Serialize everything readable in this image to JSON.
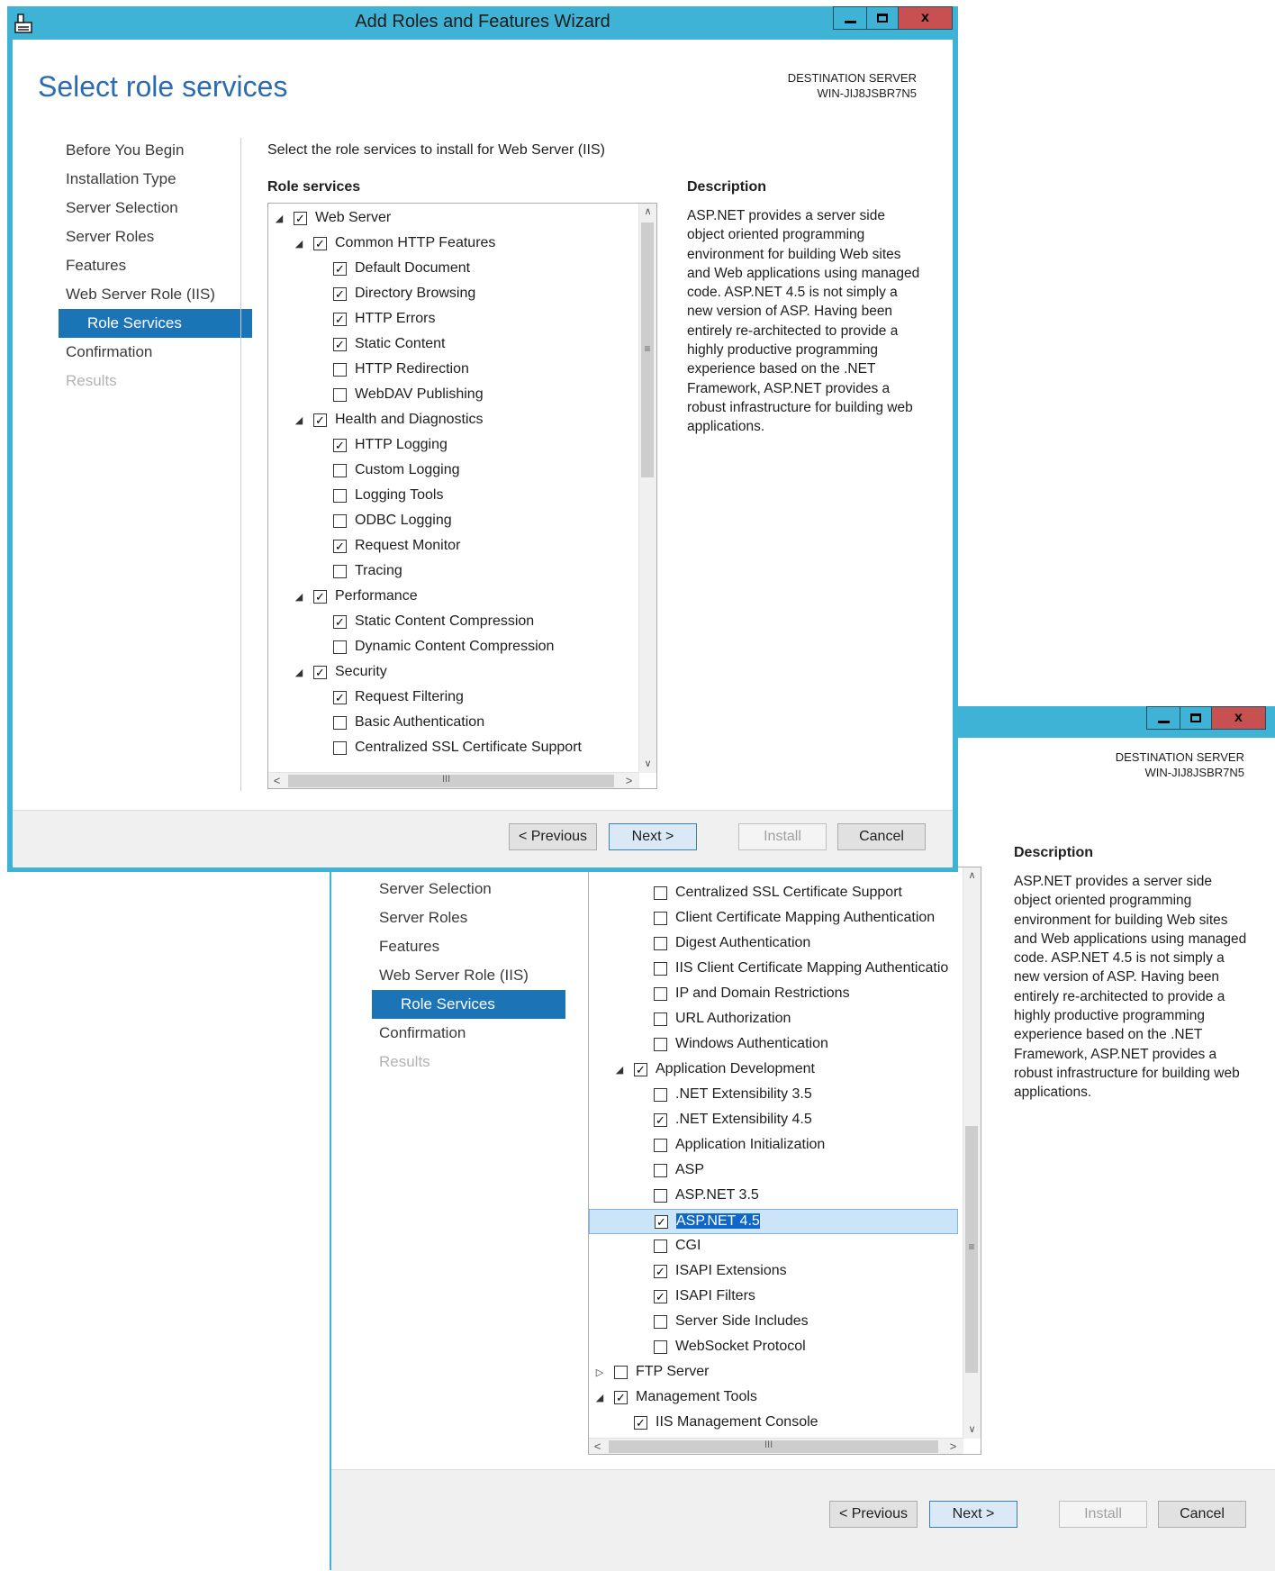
{
  "wizard_title": "Add Roles and Features Wizard",
  "heading": "Select role services",
  "destination": {
    "label": "DESTINATION SERVER",
    "server": "WIN-JIJ8JSBR7N5"
  },
  "nav_items": [
    {
      "label": "Before You Begin",
      "state": "normal"
    },
    {
      "label": "Installation Type",
      "state": "normal"
    },
    {
      "label": "Server Selection",
      "state": "normal"
    },
    {
      "label": "Server Roles",
      "state": "normal"
    },
    {
      "label": "Features",
      "state": "normal"
    },
    {
      "label": "Web Server Role (IIS)",
      "state": "normal"
    },
    {
      "label": "Role Services",
      "state": "selected"
    },
    {
      "label": "Confirmation",
      "state": "normal"
    },
    {
      "label": "Results",
      "state": "disabled"
    }
  ],
  "instruction": "Select the role services to install for Web Server (IIS)",
  "role_services_label": "Role services",
  "description_label": "Description",
  "description_text": "ASP.NET provides a server side object oriented programming environment for building Web sites and Web applications using managed code. ASP.NET 4.5 is not simply a new version of ASP. Having been entirely re-architected to provide a highly productive programming experience based on the .NET Framework, ASP.NET provides a robust infrastructure for building web applications.",
  "buttons": {
    "previous": "< Previous",
    "next": "Next >",
    "install": "Install",
    "cancel": "Cancel"
  },
  "window_buttons": {
    "close": "x"
  },
  "scroll_glyphs": {
    "up": "∧",
    "down": "∨",
    "left": "<",
    "right": ">",
    "grip_v": "≡",
    "grip_h": "III"
  },
  "tree_top": [
    {
      "label": "Web Server",
      "level": 0,
      "checked": true,
      "expander": "expanded"
    },
    {
      "label": "Common HTTP Features",
      "level": 1,
      "checked": true,
      "expander": "expanded"
    },
    {
      "label": "Default Document",
      "level": 2,
      "checked": true
    },
    {
      "label": "Directory Browsing",
      "level": 2,
      "checked": true
    },
    {
      "label": "HTTP Errors",
      "level": 2,
      "checked": true
    },
    {
      "label": "Static Content",
      "level": 2,
      "checked": true
    },
    {
      "label": "HTTP Redirection",
      "level": 2,
      "checked": false
    },
    {
      "label": "WebDAV Publishing",
      "level": 2,
      "checked": false
    },
    {
      "label": "Health and Diagnostics",
      "level": 1,
      "checked": true,
      "expander": "expanded"
    },
    {
      "label": "HTTP Logging",
      "level": 2,
      "checked": true
    },
    {
      "label": "Custom Logging",
      "level": 2,
      "checked": false
    },
    {
      "label": "Logging Tools",
      "level": 2,
      "checked": false
    },
    {
      "label": "ODBC Logging",
      "level": 2,
      "checked": false
    },
    {
      "label": "Request Monitor",
      "level": 2,
      "checked": true
    },
    {
      "label": "Tracing",
      "level": 2,
      "checked": false
    },
    {
      "label": "Performance",
      "level": 1,
      "checked": true,
      "expander": "expanded"
    },
    {
      "label": "Static Content Compression",
      "level": 2,
      "checked": true
    },
    {
      "label": "Dynamic Content Compression",
      "level": 2,
      "checked": false
    },
    {
      "label": "Security",
      "level": 1,
      "checked": true,
      "expander": "expanded"
    },
    {
      "label": "Request Filtering",
      "level": 2,
      "checked": true
    },
    {
      "label": "Basic Authentication",
      "level": 2,
      "checked": false
    },
    {
      "label": "Centralized SSL Certificate Support",
      "level": 2,
      "checked": false
    }
  ],
  "tree_bottom": [
    {
      "label": "Centralized SSL Certificate Support",
      "level": 2,
      "checked": false
    },
    {
      "label": "Client Certificate Mapping Authentication",
      "level": 2,
      "checked": false
    },
    {
      "label": "Digest Authentication",
      "level": 2,
      "checked": false
    },
    {
      "label": "IIS Client Certificate Mapping Authenticatio",
      "level": 2,
      "checked": false
    },
    {
      "label": "IP and Domain Restrictions",
      "level": 2,
      "checked": false
    },
    {
      "label": "URL Authorization",
      "level": 2,
      "checked": false
    },
    {
      "label": "Windows Authentication",
      "level": 2,
      "checked": false
    },
    {
      "label": "Application Development",
      "level": 1,
      "checked": true,
      "expander": "expanded"
    },
    {
      "label": ".NET Extensibility 3.5",
      "level": 2,
      "checked": false
    },
    {
      "label": ".NET Extensibility 4.5",
      "level": 2,
      "checked": true
    },
    {
      "label": "Application Initialization",
      "level": 2,
      "checked": false
    },
    {
      "label": "ASP",
      "level": 2,
      "checked": false
    },
    {
      "label": "ASP.NET 3.5",
      "level": 2,
      "checked": false
    },
    {
      "label": "ASP.NET 4.5",
      "level": 2,
      "checked": true,
      "selected": true
    },
    {
      "label": "CGI",
      "level": 2,
      "checked": false
    },
    {
      "label": "ISAPI Extensions",
      "level": 2,
      "checked": true
    },
    {
      "label": "ISAPI Filters",
      "level": 2,
      "checked": true
    },
    {
      "label": "Server Side Includes",
      "level": 2,
      "checked": false
    },
    {
      "label": "WebSocket Protocol",
      "level": 2,
      "checked": false
    },
    {
      "label": "FTP Server",
      "level": 0,
      "checked": false,
      "expander": "collapsed"
    },
    {
      "label": "Management Tools",
      "level": 0,
      "checked": true,
      "expander": "expanded"
    },
    {
      "label": "IIS Management Console",
      "level": 1,
      "checked": true
    }
  ],
  "colors": {
    "frame": "#3fb3d6",
    "heading": "#2b6bb0",
    "nav_selected": "#1a74b6",
    "close": "#c75050",
    "row_selected": "#cce4f7"
  }
}
